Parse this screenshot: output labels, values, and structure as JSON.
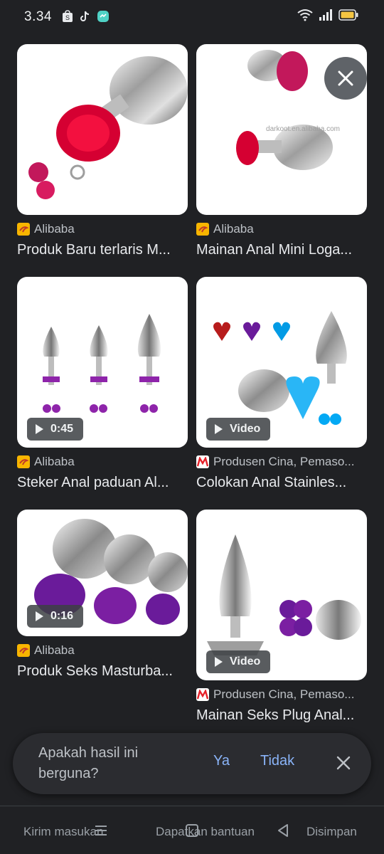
{
  "status_bar": {
    "time": "3.34",
    "left_icons": [
      "shopee-icon",
      "tiktok-icon",
      "messenger-icon"
    ],
    "right_icons": [
      "wifi-icon",
      "signal-icon",
      "battery-icon"
    ]
  },
  "results": [
    {
      "source": "Alibaba",
      "favicon": "alibaba",
      "title": "Produk Baru terlaris M...",
      "badge": null
    },
    {
      "source": "Alibaba",
      "favicon": "alibaba",
      "title": "Mainan Anal Mini Loga...",
      "badge": null,
      "watermark": "darkoot.en.alibaba.com"
    },
    {
      "source": "Alibaba",
      "favicon": "alibaba",
      "title": "Steker Anal paduan Al...",
      "badge": "0:45"
    },
    {
      "source": "Produsen Cina, Pemaso...",
      "favicon": "made-in-china",
      "title": "Colokan Anal Stainles...",
      "badge": "Video"
    },
    {
      "source": "Alibaba",
      "favicon": "alibaba",
      "title": "Produk Seks Masturba...",
      "badge": "0:16"
    },
    {
      "source": "Produsen Cina, Pemaso...",
      "favicon": "made-in-china",
      "title": "Mainan Seks Plug Anal...",
      "badge": "Video"
    }
  ],
  "feedback": {
    "question": "Apakah hasil ini berguna?",
    "yes": "Ya",
    "no": "Tidak"
  },
  "bottom_bar": {
    "send_feedback": "Kirim masukan",
    "get_help": "Dapatkan bantuan",
    "saved": "Disimpan"
  },
  "colors": {
    "background": "#202124",
    "link_blue": "#8ab4f8",
    "alibaba_orange": "#f8b500",
    "mic_red": "#e62129"
  }
}
